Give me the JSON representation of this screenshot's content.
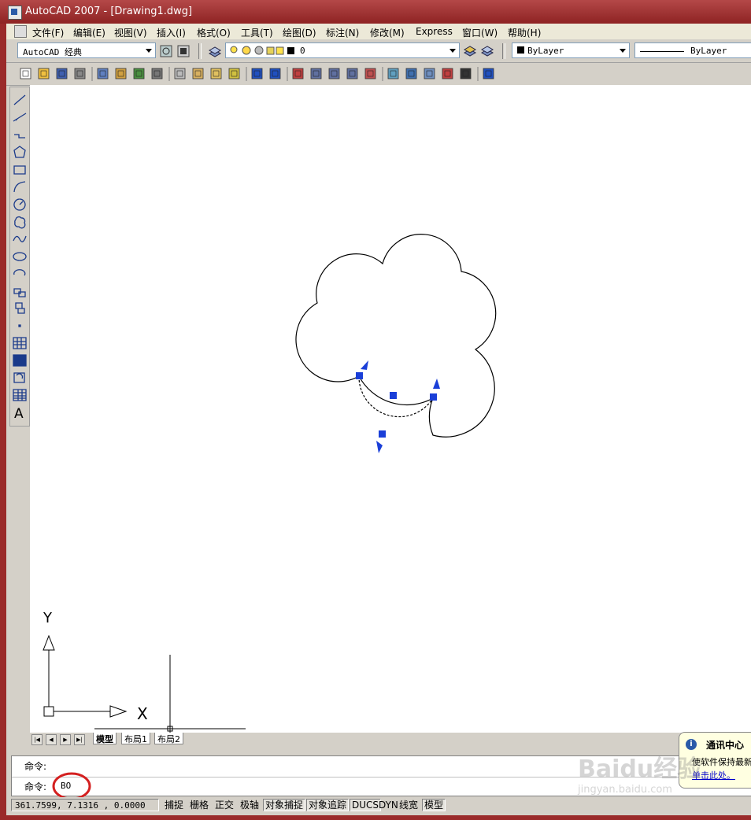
{
  "window": {
    "title": "AutoCAD 2007 - [Drawing1.dwg]"
  },
  "menu": {
    "items": [
      "文件(F)",
      "编辑(E)",
      "视图(V)",
      "插入(I)",
      "格式(O)",
      "工具(T)",
      "绘图(D)",
      "标注(N)",
      "修改(M)",
      "Express",
      "窗口(W)",
      "帮助(H)"
    ]
  },
  "toolbar1": {
    "workspace": "AutoCAD 经典",
    "layer": "0",
    "color": "ByLayer",
    "linetype": "ByLayer"
  },
  "toolbar2": {
    "icons": [
      "new-icon",
      "open-icon",
      "save-icon",
      "plot-icon",
      "plot-preview-icon",
      "publish-icon",
      "3d-dwf-icon",
      "cut-icon",
      "copy-icon",
      "paste-icon",
      "match-properties-icon",
      "block-editor-icon",
      "undo-icon",
      "redo-icon",
      "pan-icon",
      "zoom-realtime-icon",
      "zoom-window-icon",
      "zoom-previous-icon",
      "properties-icon",
      "design-center-icon",
      "tool-palettes-icon",
      "sheet-set-icon",
      "markup-icon",
      "calculator-icon",
      "help-icon"
    ]
  },
  "draw_toolbar": {
    "icons": [
      "line-icon",
      "construction-line-icon",
      "polyline-icon",
      "polygon-icon",
      "rectangle-icon",
      "arc-icon",
      "circle-icon",
      "revision-cloud-icon",
      "spline-icon",
      "ellipse-icon",
      "ellipse-arc-icon",
      "insert-block-icon",
      "make-block-icon",
      "point-icon",
      "hatch-icon",
      "gradient-icon",
      "region-icon",
      "table-icon",
      "multiline-text-icon"
    ],
    "text_glyph": "A"
  },
  "ucs": {
    "y_label": "Y",
    "x_label": "X"
  },
  "tabs": {
    "model": "模型",
    "layout1": "布局1",
    "layout2": "布局2"
  },
  "command": {
    "prompt1": "命令:",
    "prompt2": "命令:",
    "input": "BO"
  },
  "status": {
    "coords": "361.7599,  7.1316  , 0.0000",
    "buttons": [
      {
        "label": "捕捉",
        "on": false
      },
      {
        "label": "栅格",
        "on": false
      },
      {
        "label": "正交",
        "on": false
      },
      {
        "label": "极轴",
        "on": false
      },
      {
        "label": "对象捕捉",
        "on": true
      },
      {
        "label": "对象追踪",
        "on": true
      },
      {
        "label": "DUCS",
        "on": true
      },
      {
        "label": "DYN",
        "on": false
      },
      {
        "label": "线宽",
        "on": false
      },
      {
        "label": "模型",
        "on": true
      }
    ]
  },
  "comm_center": {
    "title": "通讯中心",
    "body": "使软件保持最新",
    "link": "单击此处。"
  },
  "watermark": {
    "text": "Baidu经验",
    "url": "jingyan.baidu.com"
  },
  "colors": {
    "title_bar": "#9a2a2a",
    "grip": "#1a3fd8",
    "highlight_circle": "#d42020"
  }
}
